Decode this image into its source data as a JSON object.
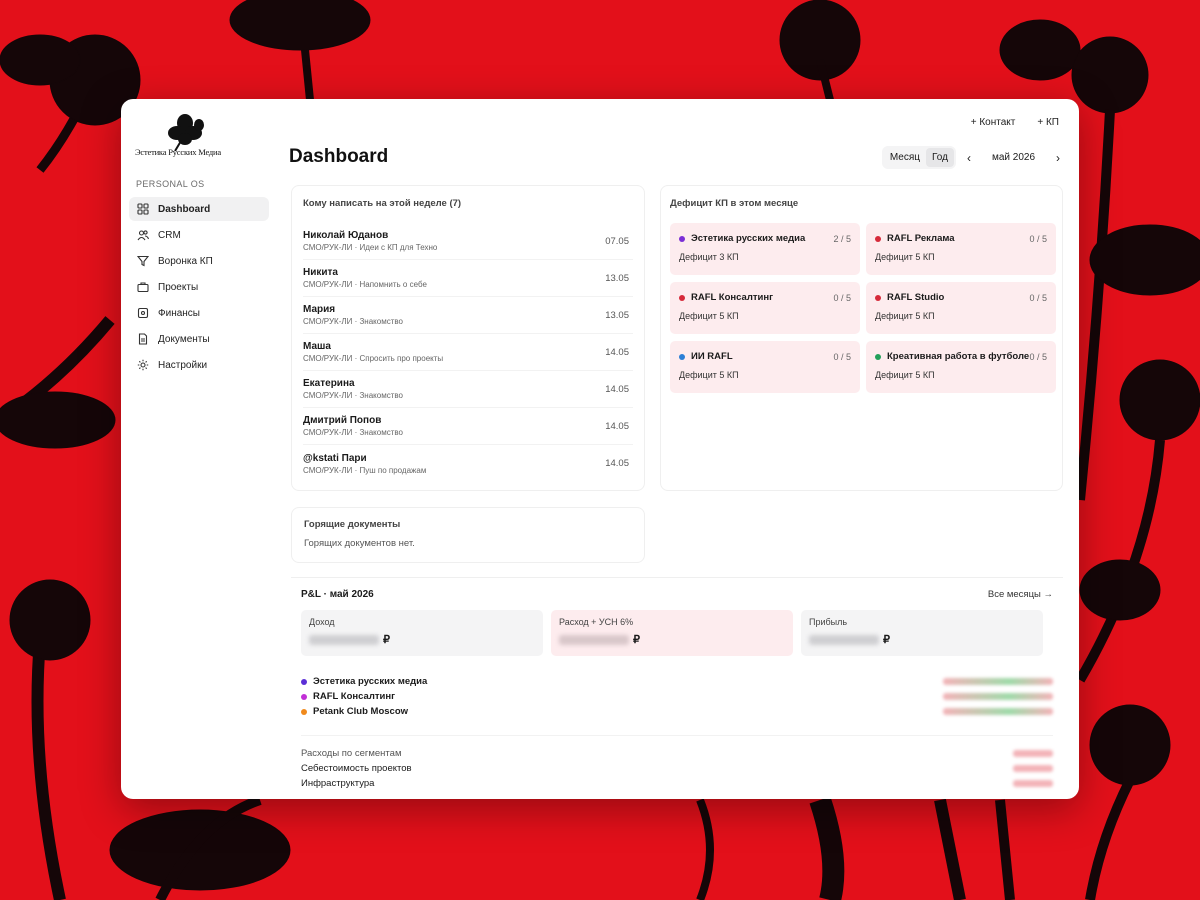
{
  "app": {
    "logo_text": "Эстетика Русских Медиа",
    "section_label": "PERSONAL OS",
    "page_title": "Dashboard"
  },
  "sidebar": {
    "items": [
      {
        "label": "Dashboard",
        "icon": "grid-icon",
        "active": true
      },
      {
        "label": "CRM",
        "icon": "users-icon"
      },
      {
        "label": "Воронка КП",
        "icon": "funnel-icon"
      },
      {
        "label": "Проекты",
        "icon": "briefcase-icon"
      },
      {
        "label": "Финансы",
        "icon": "wallet-icon"
      },
      {
        "label": "Документы",
        "icon": "document-icon"
      },
      {
        "label": "Настройки",
        "icon": "gear-icon"
      }
    ]
  },
  "actions": {
    "contact": "+ Контакт",
    "kp": "+ КП"
  },
  "period": {
    "month": "Месяц",
    "year": "Год",
    "label": "май 2026",
    "prev": "‹",
    "next": "›"
  },
  "write": {
    "title": "Кому написать на этой неделе (7)",
    "rows": [
      {
        "name": "Николай Юданов",
        "sub": "СМО/РУК-ЛИ · Идеи с КП для Техно",
        "date": "07.05"
      },
      {
        "name": "Никита",
        "sub": "СМО/РУК-ЛИ · Напомнить о себе",
        "date": "13.05"
      },
      {
        "name": "Мария",
        "sub": "СМО/РУК-ЛИ · Знакомство",
        "date": "13.05"
      },
      {
        "name": "Маша",
        "sub": "СМО/РУК-ЛИ · Спросить про проекты",
        "date": "14.05"
      },
      {
        "name": "Екатерина",
        "sub": "СМО/РУК-ЛИ · Знакомство",
        "date": "14.05"
      },
      {
        "name": "Дмитрий Попов",
        "sub": "СМО/РУК-ЛИ · Знакомство",
        "date": "14.05"
      },
      {
        "name": "@kstati Пари",
        "sub": "СМО/РУК-ЛИ · Пуш по продажам",
        "date": "14.05"
      }
    ]
  },
  "deficit": {
    "title": "Дефицит КП в этом месяце",
    "items": [
      {
        "name": "Эстетика русских медиа",
        "count": "2 / 5",
        "sub": "Дефицит 3 КП",
        "color": "#7b2fd6"
      },
      {
        "name": "RAFL Реклама",
        "count": "0 / 5",
        "sub": "Дефицит 5 КП",
        "color": "#d62a3a"
      },
      {
        "name": "RAFL Консалтинг",
        "count": "0 / 5",
        "sub": "Дефицит 5 КП",
        "color": "#d62a3a"
      },
      {
        "name": "RAFL Studio",
        "count": "0 / 5",
        "sub": "Дефицит 5 КП",
        "color": "#d62a3a"
      },
      {
        "name": "ИИ RAFL",
        "count": "0 / 5",
        "sub": "Дефицит 5 КП",
        "color": "#2b7fd6"
      },
      {
        "name": "Креативная работа в футболе",
        "count": "0 / 5",
        "sub": "Дефицит 5 КП",
        "color": "#22a05a"
      }
    ]
  },
  "hot_docs": {
    "title": "Горящие документы",
    "empty": "Горящих документов нет."
  },
  "pl": {
    "title": "P&L · май 2026",
    "all_months": "Все месяцы →",
    "metrics": [
      {
        "label": "Доход",
        "currency": "₽",
        "kind": "income"
      },
      {
        "label": "Расход + УСН 6%",
        "currency": "₽",
        "kind": "expense"
      },
      {
        "label": "Прибыль",
        "currency": "₽",
        "kind": "profit"
      }
    ],
    "clients": [
      {
        "name": "Эстетика русских медиа",
        "color": "#5b2fd6"
      },
      {
        "name": "RAFL Консалтинг",
        "color": "#c12fd6"
      },
      {
        "name": "Petank Club Moscow",
        "color": "#f08a1c"
      }
    ],
    "segments_title": "Расходы по сегментам",
    "segments": [
      "Себестоимость проектов",
      "Инфраструктура"
    ]
  }
}
